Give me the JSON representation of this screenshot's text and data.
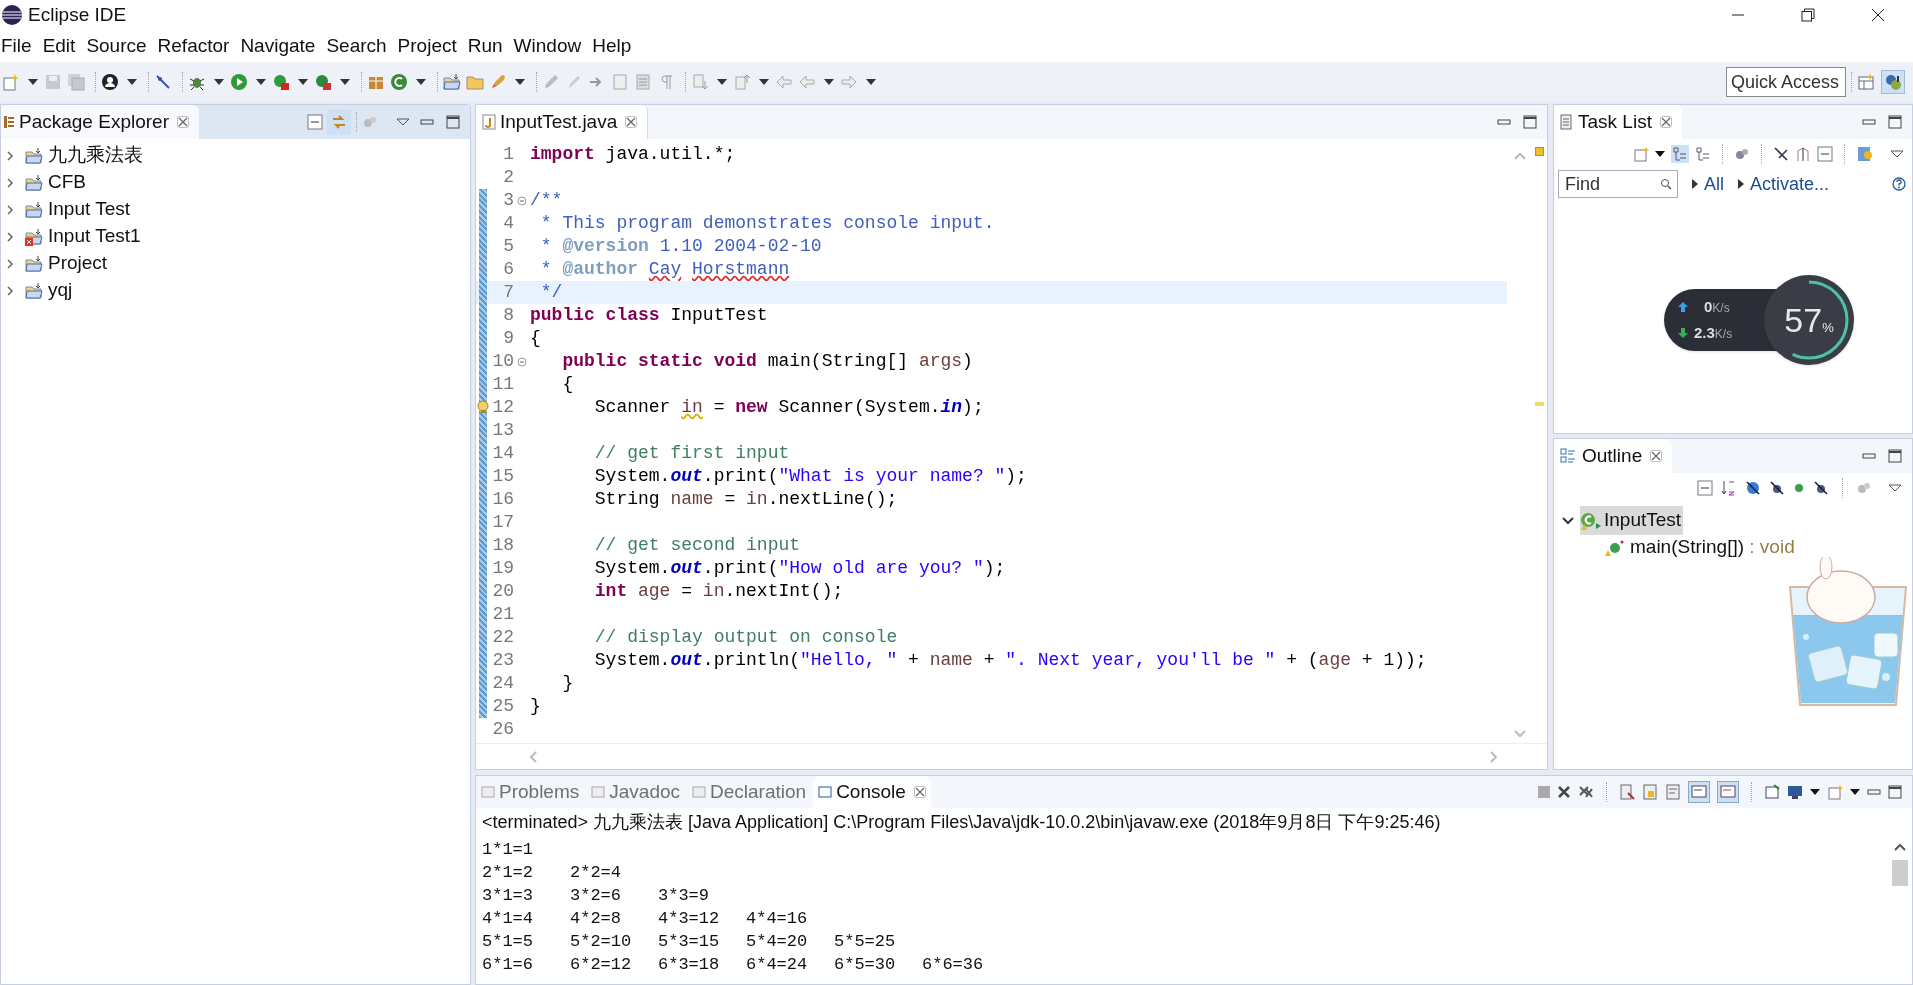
{
  "window": {
    "title": "Eclipse IDE"
  },
  "menu": [
    "File",
    "Edit",
    "Source",
    "Refactor",
    "Navigate",
    "Search",
    "Project",
    "Run",
    "Window",
    "Help"
  ],
  "quick_access": {
    "placeholder": "Quick Access"
  },
  "package_explorer": {
    "title": "Package Explorer",
    "projects": [
      {
        "name": "九九乘法表",
        "error": false,
        "expanded": false
      },
      {
        "name": "CFB",
        "error": false,
        "expanded": false
      },
      {
        "name": "Input Test",
        "error": false,
        "expanded": false
      },
      {
        "name": "Input Test1",
        "error": true,
        "expanded": false
      },
      {
        "name": "Project",
        "error": false,
        "expanded": false
      },
      {
        "name": "yqj",
        "error": false,
        "expanded": false
      }
    ]
  },
  "editor": {
    "tab": "InputTest.java",
    "lines": [
      {
        "number": "1",
        "changed": false,
        "highlighted": false,
        "fold": false,
        "warning": false,
        "tokens": [
          {
            "kind": "keyword",
            "text": "import"
          },
          {
            "kind": "plain",
            "text": " java.util.*;"
          }
        ]
      },
      {
        "number": "2",
        "changed": false,
        "highlighted": false,
        "fold": false,
        "warning": false
      },
      {
        "number": "3",
        "changed": true,
        "highlighted": false,
        "fold": true,
        "warning": false,
        "tokens": [
          {
            "kind": "doc",
            "text": "/**"
          }
        ]
      },
      {
        "number": "4",
        "changed": true,
        "highlighted": false,
        "fold": false,
        "warning": false,
        "tokens": [
          {
            "kind": "doc",
            "text": " * This program demonstrates console input."
          }
        ]
      },
      {
        "number": "5",
        "changed": true,
        "highlighted": false,
        "fold": false,
        "warning": false,
        "tokens": [
          {
            "kind": "doc",
            "text": " * "
          },
          {
            "kind": "doctag",
            "text": "@version"
          },
          {
            "kind": "doc",
            "text": " 1.10 2004-02-10"
          }
        ]
      },
      {
        "number": "6",
        "changed": true,
        "highlighted": false,
        "fold": false,
        "warning": false,
        "tokens": [
          {
            "kind": "doc",
            "text": " * "
          },
          {
            "kind": "doctag",
            "text": "@author"
          },
          {
            "kind": "doc_misspelled",
            "text": " Cay"
          },
          {
            "kind": "doc_misspelled",
            "text": " Horstmann"
          }
        ]
      },
      {
        "number": "7",
        "changed": true,
        "highlighted": true,
        "fold": false,
        "warning": false,
        "tokens": [
          {
            "kind": "doc",
            "text": " */"
          }
        ]
      },
      {
        "number": "8",
        "changed": true,
        "highlighted": false,
        "fold": false,
        "warning": false,
        "tokens": [
          {
            "kind": "keyword",
            "text": "public class"
          },
          {
            "kind": "plain",
            "text": " InputTest"
          }
        ]
      },
      {
        "number": "9",
        "changed": true,
        "highlighted": false,
        "fold": false,
        "warning": false,
        "tokens": [
          {
            "kind": "plain",
            "text": "{"
          }
        ]
      },
      {
        "number": "10",
        "changed": true,
        "highlighted": false,
        "fold": true,
        "warning": false,
        "tokens": [
          {
            "kind": "keyword",
            "text": "   public static void"
          },
          {
            "kind": "plain",
            "text": " main(String[] "
          },
          {
            "kind": "local",
            "text": "args"
          },
          {
            "kind": "plain",
            "text": ")"
          }
        ]
      },
      {
        "number": "11",
        "changed": true,
        "highlighted": false,
        "fold": false,
        "warning": false,
        "tokens": [
          {
            "kind": "plain",
            "text": "   {"
          }
        ]
      },
      {
        "number": "12",
        "changed": true,
        "highlighted": false,
        "fold": false,
        "warning": true,
        "tokens": [
          {
            "kind": "plain",
            "text": "      Scanner "
          },
          {
            "kind": "local_warning",
            "text": "in"
          },
          {
            "kind": "plain",
            "text": " = "
          },
          {
            "kind": "keyword",
            "text": "new"
          },
          {
            "kind": "plain",
            "text": " Scanner(System."
          },
          {
            "kind": "field",
            "text": "in"
          },
          {
            "kind": "plain",
            "text": ");"
          }
        ]
      },
      {
        "number": "13",
        "changed": true,
        "highlighted": false,
        "fold": false,
        "warning": false
      },
      {
        "number": "14",
        "changed": true,
        "highlighted": false,
        "fold": false,
        "warning": false,
        "tokens": [
          {
            "kind": "comment",
            "text": "      // get first input"
          }
        ]
      },
      {
        "number": "15",
        "changed": true,
        "highlighted": false,
        "fold": false,
        "warning": false,
        "tokens": [
          {
            "kind": "plain",
            "text": "      System."
          },
          {
            "kind": "field",
            "text": "out"
          },
          {
            "kind": "plain",
            "text": ".print("
          },
          {
            "kind": "string",
            "text": "\"What is your name? \""
          },
          {
            "kind": "plain",
            "text": ");"
          }
        ]
      },
      {
        "number": "16",
        "changed": true,
        "highlighted": false,
        "fold": false,
        "warning": false,
        "tokens": [
          {
            "kind": "plain",
            "text": "      String "
          },
          {
            "kind": "local",
            "text": "name"
          },
          {
            "kind": "plain",
            "text": " = "
          },
          {
            "kind": "local",
            "text": "in"
          },
          {
            "kind": "plain",
            "text": ".nextLine();"
          }
        ]
      },
      {
        "number": "17",
        "changed": true,
        "highlighted": false,
        "fold": false,
        "warning": false
      },
      {
        "number": "18",
        "changed": true,
        "highlighted": false,
        "fold": false,
        "warning": false,
        "tokens": [
          {
            "kind": "comment",
            "text": "      // get second input"
          }
        ]
      },
      {
        "number": "19",
        "changed": true,
        "highlighted": false,
        "fold": false,
        "warning": false,
        "tokens": [
          {
            "kind": "plain",
            "text": "      System."
          },
          {
            "kind": "field",
            "text": "out"
          },
          {
            "kind": "plain",
            "text": ".print("
          },
          {
            "kind": "string",
            "text": "\"How old are you? \""
          },
          {
            "kind": "plain",
            "text": ");"
          }
        ]
      },
      {
        "number": "20",
        "changed": true,
        "highlighted": false,
        "fold": false,
        "warning": false,
        "tokens": [
          {
            "kind": "keyword",
            "text": "      int"
          },
          {
            "kind": "local",
            "text": " age"
          },
          {
            "kind": "plain",
            "text": " = "
          },
          {
            "kind": "local",
            "text": "in"
          },
          {
            "kind": "plain",
            "text": ".nextInt();"
          }
        ]
      },
      {
        "number": "21",
        "changed": true,
        "highlighted": false,
        "fold": false,
        "warning": false
      },
      {
        "number": "22",
        "changed": true,
        "highlighted": false,
        "fold": false,
        "warning": false,
        "tokens": [
          {
            "kind": "comment",
            "text": "      // display output on console"
          }
        ]
      },
      {
        "number": "23",
        "changed": true,
        "highlighted": false,
        "fold": false,
        "warning": false,
        "tokens": [
          {
            "kind": "plain",
            "text": "      System."
          },
          {
            "kind": "field",
            "text": "out"
          },
          {
            "kind": "plain",
            "text": ".println("
          },
          {
            "kind": "string",
            "text": "\"Hello, \""
          },
          {
            "kind": "plain",
            "text": " + "
          },
          {
            "kind": "local",
            "text": "name"
          },
          {
            "kind": "plain",
            "text": " + "
          },
          {
            "kind": "string",
            "text": "\". Next year, you'll be \""
          },
          {
            "kind": "plain",
            "text": " + ("
          },
          {
            "kind": "local",
            "text": "age"
          },
          {
            "kind": "plain",
            "text": " + 1));"
          }
        ]
      },
      {
        "number": "24",
        "changed": true,
        "highlighted": false,
        "fold": false,
        "warning": false,
        "tokens": [
          {
            "kind": "plain",
            "text": "   }"
          }
        ]
      },
      {
        "number": "25",
        "changed": true,
        "highlighted": false,
        "fold": false,
        "warning": false,
        "tokens": [
          {
            "kind": "plain",
            "text": "}"
          }
        ]
      },
      {
        "number": "26",
        "changed": false,
        "highlighted": false,
        "fold": false,
        "warning": false
      }
    ]
  },
  "task_list": {
    "title": "Task List",
    "search": {
      "placeholder": "Find"
    },
    "links": [
      "All",
      "Activate..."
    ]
  },
  "network_monitor": {
    "upload": {
      "value": "0",
      "unit": "K/s"
    },
    "download": {
      "value": "2.3",
      "unit": "K/s"
    },
    "usage": {
      "value": "57",
      "unit": "%",
      "level": 0.57
    }
  },
  "outline": {
    "title": "Outline",
    "tree": [
      {
        "label": "InputTest",
        "selected": true,
        "expanded": true,
        "children": [
          {
            "label": "main(String[])",
            "detail": " : void",
            "selected": false
          }
        ]
      }
    ]
  },
  "sticker": {
    "kind": "picture"
  },
  "console": {
    "tabs": [
      {
        "label": "Problems",
        "selected": false
      },
      {
        "label": "Javadoc",
        "selected": false
      },
      {
        "label": "Declaration",
        "selected": false
      },
      {
        "label": "Console",
        "selected": true
      }
    ],
    "header": "<terminated> 九九乘法表 [Java Application] C:\\Program Files\\Java\\jdk-10.0.2\\bin\\javaw.exe (2018年9月8日 下午9:25:46)",
    "output": [
      "1*1=1",
      "2*1=2\t2*2=4",
      "3*1=3\t3*2=6\t3*3=9",
      "4*1=4\t4*2=8\t4*3=12\t4*4=16",
      "5*1=5\t5*2=10\t5*3=15\t5*4=20\t5*5=25",
      "6*1=6\t6*2=12\t6*3=18\t6*4=24\t6*5=30\t6*6=36"
    ]
  }
}
